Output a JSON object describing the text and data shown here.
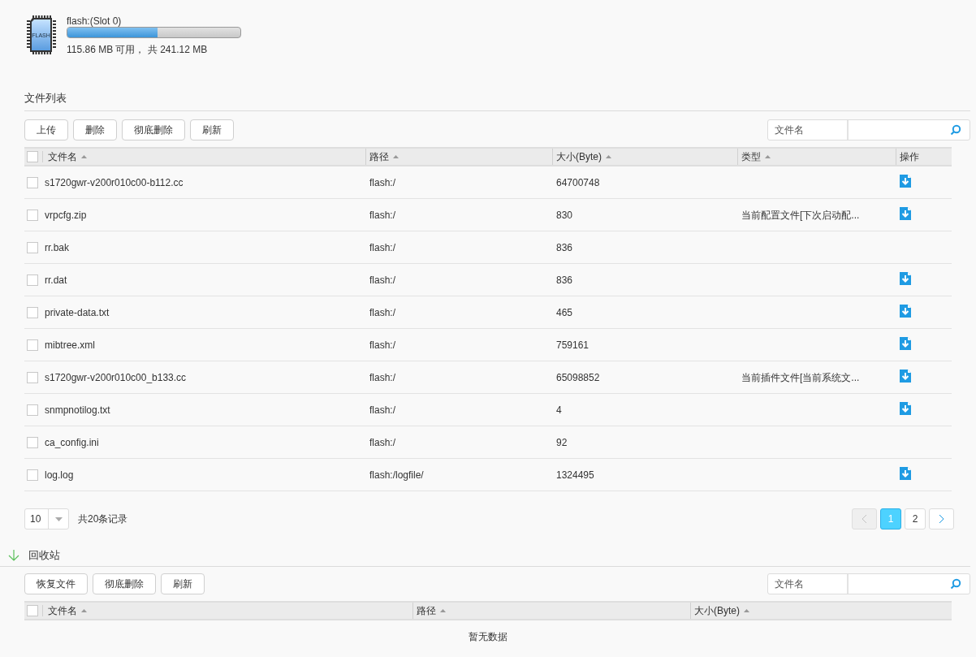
{
  "storage": {
    "name": "flash:(Slot 0)",
    "level": 0.52,
    "summary": "115.86 MB 可用， 共 241.12 MB",
    "chip_label": "FLASH"
  },
  "file_list": {
    "title": "文件列表",
    "buttons": [
      "上传",
      "删除",
      "彻底删除",
      "刷新"
    ],
    "search": {
      "label": "文件名"
    },
    "columns": [
      {
        "label": "文件名",
        "sortable": true
      },
      {
        "label": "路径",
        "sortable": true
      },
      {
        "label": "大小(Byte)",
        "sortable": true
      },
      {
        "label": "类型",
        "sortable": true
      },
      {
        "label": "操作",
        "sortable": false
      }
    ],
    "all_checked": false,
    "rows": [
      {
        "name": "s1720gwr-v200r010c00-b112.cc",
        "path": "flash:/",
        "size": "64700748",
        "type": "",
        "checked": false,
        "downloadable": true
      },
      {
        "name": "vrpcfg.zip",
        "path": "flash:/",
        "size": "830",
        "type": "当前配置文件[下次启动配...",
        "checked": false,
        "downloadable": true
      },
      {
        "name": "rr.bak",
        "path": "flash:/",
        "size": "836",
        "type": "",
        "checked": false,
        "downloadable": false
      },
      {
        "name": "rr.dat",
        "path": "flash:/",
        "size": "836",
        "type": "",
        "checked": false,
        "downloadable": true
      },
      {
        "name": "private-data.txt",
        "path": "flash:/",
        "size": "465",
        "type": "",
        "checked": false,
        "downloadable": true
      },
      {
        "name": "mibtree.xml",
        "path": "flash:/",
        "size": "759161",
        "type": "",
        "checked": false,
        "downloadable": true
      },
      {
        "name": "s1720gwr-v200r010c00_b133.cc",
        "path": "flash:/",
        "size": "65098852",
        "type": "当前插件文件[当前系统文...",
        "checked": false,
        "downloadable": true
      },
      {
        "name": "snmpnotilog.txt",
        "path": "flash:/",
        "size": "4",
        "type": "",
        "checked": false,
        "downloadable": true
      },
      {
        "name": "ca_config.ini",
        "path": "flash:/",
        "size": "92",
        "type": "",
        "checked": false,
        "downloadable": false
      },
      {
        "name": "log.log",
        "path": "flash:/logfile/",
        "size": "1324495",
        "type": "",
        "checked": false,
        "downloadable": true
      }
    ],
    "page_size": "10",
    "total": "共20条记录",
    "pages": [
      {
        "label": "1",
        "selected": true
      },
      {
        "label": "2",
        "selected": false
      }
    ],
    "prev_disabled": true,
    "next_disabled": false
  },
  "recycle_bin": {
    "title": "回收站",
    "expanded": true,
    "buttons": [
      "恢复文件",
      "彻底删除",
      "刷新"
    ],
    "search": {
      "label": "文件名"
    },
    "columns": [
      {
        "label": "文件名",
        "sortable": true
      },
      {
        "label": "路径",
        "sortable": true
      },
      {
        "label": "大小(Byte)",
        "sortable": true
      }
    ],
    "all_checked": false,
    "empty_text": "暂无数据"
  }
}
